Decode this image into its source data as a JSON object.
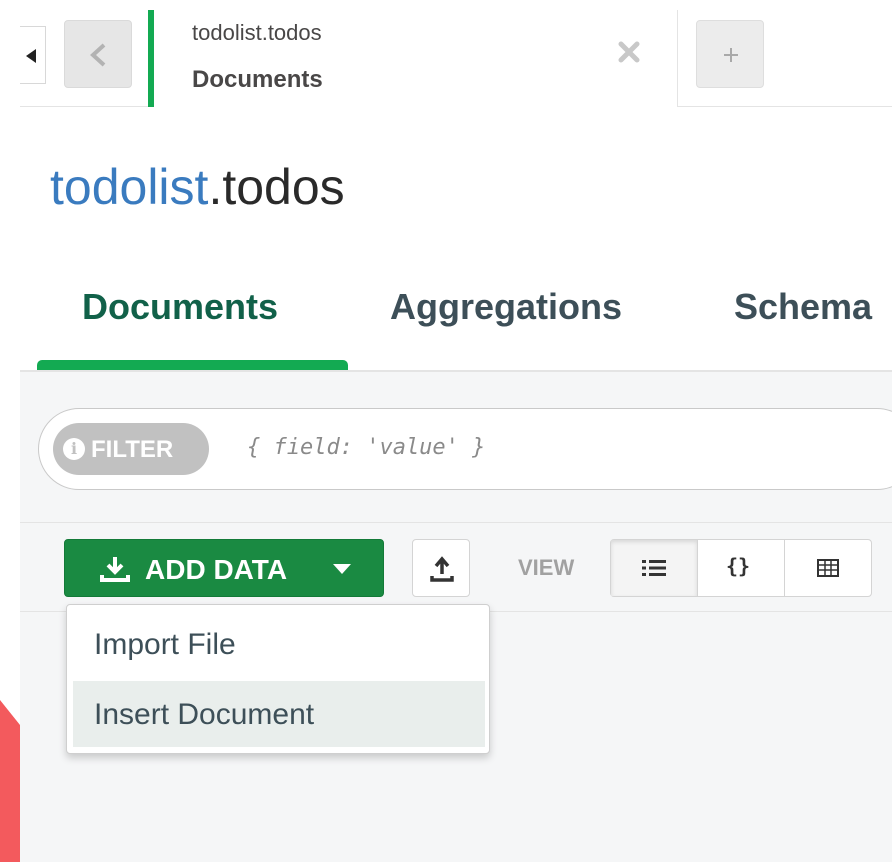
{
  "tab": {
    "namespace": "todolist.todos",
    "subtitle": "Documents"
  },
  "title": {
    "database": "todolist",
    "collection": ".todos"
  },
  "subtabs": [
    {
      "label": "Documents",
      "active": true
    },
    {
      "label": "Aggregations",
      "active": false
    },
    {
      "label": "Schema",
      "active": false
    }
  ],
  "filter": {
    "badge": "FILTER",
    "placeholder": "{ field: 'value' }"
  },
  "toolbar": {
    "add_data_label": "ADD DATA",
    "view_label": "VIEW"
  },
  "dropdown": {
    "items": [
      "Import File",
      "Insert Document"
    ]
  },
  "colors": {
    "accent_green": "#13aa52",
    "button_green": "#1a8a42",
    "db_blue": "#3a7bbf",
    "red_accent": "#f35a5d"
  },
  "icons": [
    "chevron-left-icon",
    "close-icon",
    "plus-icon",
    "info-icon",
    "download-icon",
    "caret-down-icon",
    "upload-icon",
    "list-view-icon",
    "json-view-icon",
    "table-view-icon"
  ]
}
